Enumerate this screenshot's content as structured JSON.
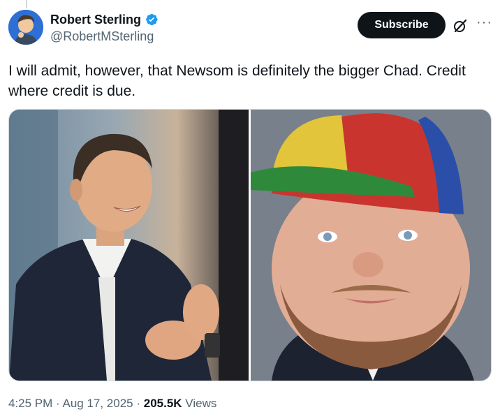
{
  "author": {
    "display_name": "Robert Sterling",
    "handle": "@RobertMSterling",
    "avatar_icon": "cartoon-avatar",
    "verified_icon": "verified-badge-icon",
    "verified_color": "#1d9bf0"
  },
  "actions": {
    "subscribe_label": "Subscribe",
    "grok_icon": "grok-icon",
    "more_icon": "more-icon",
    "more_label": "···"
  },
  "tweet": {
    "text": "I will admit, however, that Newsom is definitely the bigger Chad. Credit where credit is due."
  },
  "media": {
    "images": [
      {
        "name": "photo-man-in-suit"
      },
      {
        "name": "photo-man-with-propeller-cap"
      }
    ]
  },
  "meta": {
    "time": "4:25 PM",
    "sep1": " · ",
    "date": "Aug 17, 2025",
    "sep2": " · ",
    "views_count": "205.5K",
    "views_label": " Views"
  },
  "colors": {
    "text": "#0f1419",
    "secondary": "#536471",
    "button_bg": "#0f1419"
  }
}
